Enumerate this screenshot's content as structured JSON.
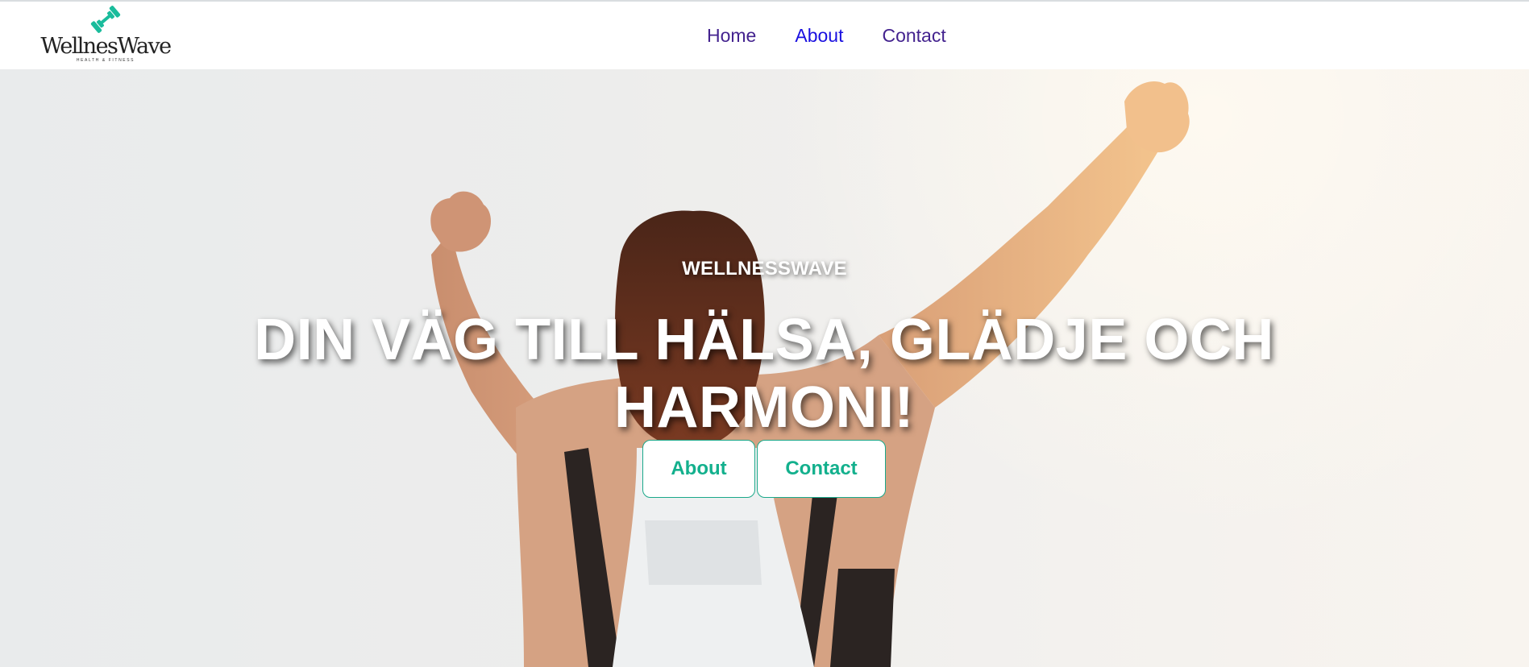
{
  "brand": {
    "name": "WellnesWave",
    "tagline": "HEALTH & FITNESS",
    "accent_color": "#1abc9c",
    "icon": "dumbbell-icon"
  },
  "nav": {
    "items": [
      {
        "label": "Home"
      },
      {
        "label": "About"
      },
      {
        "label": "Contact"
      }
    ]
  },
  "hero": {
    "kicker": "WELLNESSWAVE",
    "headline": "DIN VÄG TILL HÄLSA, GLÄDJE OCH HARMONI!",
    "buttons": {
      "about": "About",
      "contact": "Contact"
    },
    "image": "woman-raising-arms-photo"
  }
}
